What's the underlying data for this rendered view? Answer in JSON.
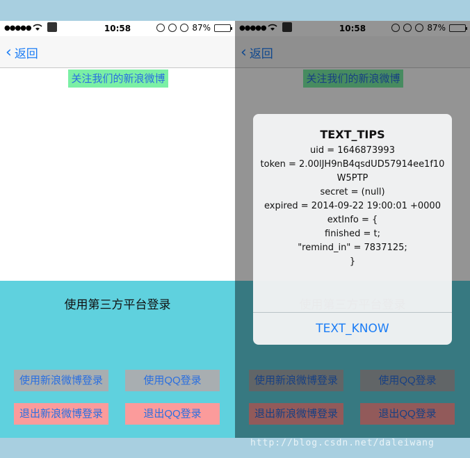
{
  "status_bar": {
    "signal": "●●●●●",
    "time": "10:58",
    "battery_text": "87%",
    "battery_level": 0.87
  },
  "nav": {
    "back_label": "返回"
  },
  "main": {
    "weibo_follow_label": "关注我们的新浪微博",
    "login_title": "使用第三方平台登录",
    "buttons": {
      "weibo_login": "使用新浪微博登录",
      "qq_login": "使用QQ登录",
      "weibo_logout": "退出新浪微博登录",
      "qq_logout": "退出QQ登录"
    }
  },
  "alert": {
    "title": "TEXT_TIPS",
    "message": "uid = 1646873993\ntoken = 2.00lJH9nB4qsdUD57914ee1f10W5PTP\nsecret = (null)\nexpired = 2014-09-22 19:00:01 +0000\nextInfo = {\nfinished = t;\n\"remind_in\" = 7837125;\n}",
    "button_label": "TEXT_KNOW"
  },
  "watermark": "http://blog.csdn.net/daleiwang",
  "colors": {
    "accent": "#1a7cf5",
    "weibo_bg": "#7bf0a5",
    "panel_bg": "#5fd1de",
    "btn_gray": "#a8aeb1",
    "btn_red": "#fb9b9b"
  }
}
